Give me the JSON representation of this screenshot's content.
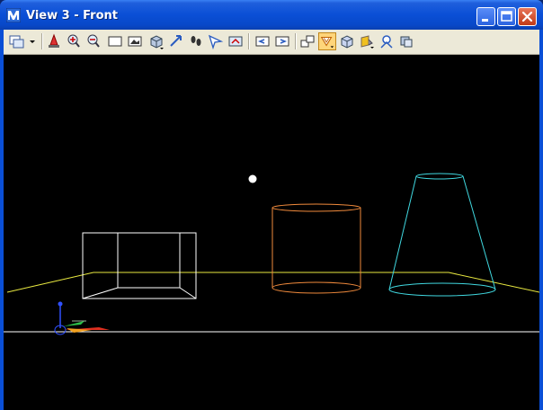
{
  "window": {
    "title": "View 3 - Front"
  },
  "title_buttons": [
    "minimize",
    "maximize",
    "close"
  ],
  "toolbar": {
    "tools": [
      {
        "name": "view-display-menu-icon"
      },
      {
        "name": "update-view-icon"
      },
      {
        "name": "zoom-in-icon"
      },
      {
        "name": "zoom-out-icon"
      },
      {
        "name": "window-area-icon"
      },
      {
        "name": "fit-view-icon"
      },
      {
        "name": "rotate-view-icon"
      },
      {
        "name": "pan-view-icon"
      },
      {
        "name": "walk-icon"
      },
      {
        "name": "fly-icon"
      },
      {
        "name": "navigate-icon"
      },
      {
        "name": "view-previous-icon"
      },
      {
        "name": "view-next-icon"
      },
      {
        "name": "copy-view-icon"
      },
      {
        "name": "clip-volume-icon"
      },
      {
        "name": "render-mode-icon",
        "active": true
      },
      {
        "name": "display-style-icon"
      },
      {
        "name": "camera-icon"
      },
      {
        "name": "view-attributes-icon"
      }
    ]
  },
  "scene": {
    "background": "#000000",
    "ground_color": "#e8e840",
    "horizon_color": "#ffffff",
    "box_color": "#ffffff",
    "cylinder_color": "#f08a3c",
    "cone_color": "#40d8e0",
    "point_color": "#ffffff"
  }
}
